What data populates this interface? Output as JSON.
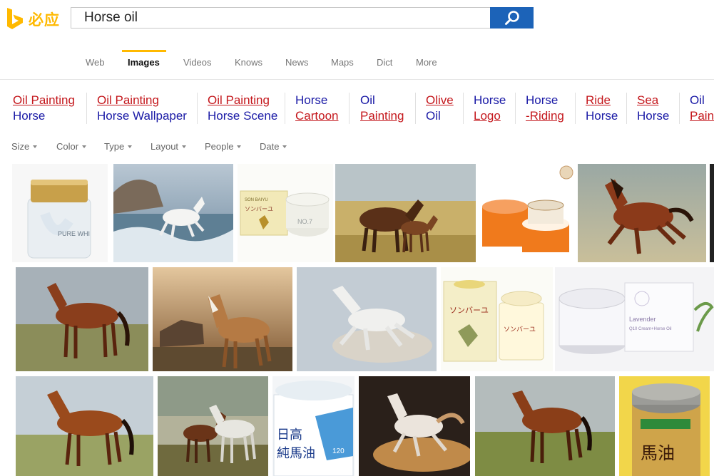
{
  "brand": {
    "name": "必应"
  },
  "search": {
    "query": "Horse oil"
  },
  "scopes": [
    "Web",
    "Images",
    "Videos",
    "Knows",
    "News",
    "Maps",
    "Dict",
    "More"
  ],
  "active_scope": "Images",
  "related": [
    {
      "line1": "Oil Painting",
      "line2": "Horse"
    },
    {
      "line1": "Oil Painting",
      "line2": "Horse Wallpaper"
    },
    {
      "line1": "Oil Painting",
      "line2": "Horse Scene"
    },
    {
      "line1": "Horse",
      "line2": "Cartoon"
    },
    {
      "line1": "Oil",
      "line2": "Painting"
    },
    {
      "line1": "Olive",
      "line2": "Oil"
    },
    {
      "line1": "Horse",
      "line2": "Logo"
    },
    {
      "line1": "Horse",
      "line2": "-Riding"
    },
    {
      "line1": "Ride",
      "line2": "Horse"
    },
    {
      "line1": "Sea",
      "line2": "Horse"
    },
    {
      "line1": "Oil",
      "line2": "Painting"
    }
  ],
  "filters": [
    "Size",
    "Color",
    "Type",
    "Layout",
    "People",
    "Date"
  ],
  "image_text": {
    "pure_white": "PURE WHI",
    "sonbaiyu_brand": "SON BAIYU",
    "sonbaiyu_name": "ソンバーユ",
    "no7": "NO.7",
    "lavender_line1": "Lavender",
    "lavender_line2": "Q10 Cream+Horse Oil",
    "hidaka_line1": "日高",
    "hidaka_line2": "純馬油",
    "hidaka_num": "120",
    "uma_big": "馬油"
  },
  "colors": {
    "accent": "#ffb900",
    "search_button": "#1c63b8",
    "link_red": "#c4171c",
    "link_blue": "#1a1aa6"
  }
}
